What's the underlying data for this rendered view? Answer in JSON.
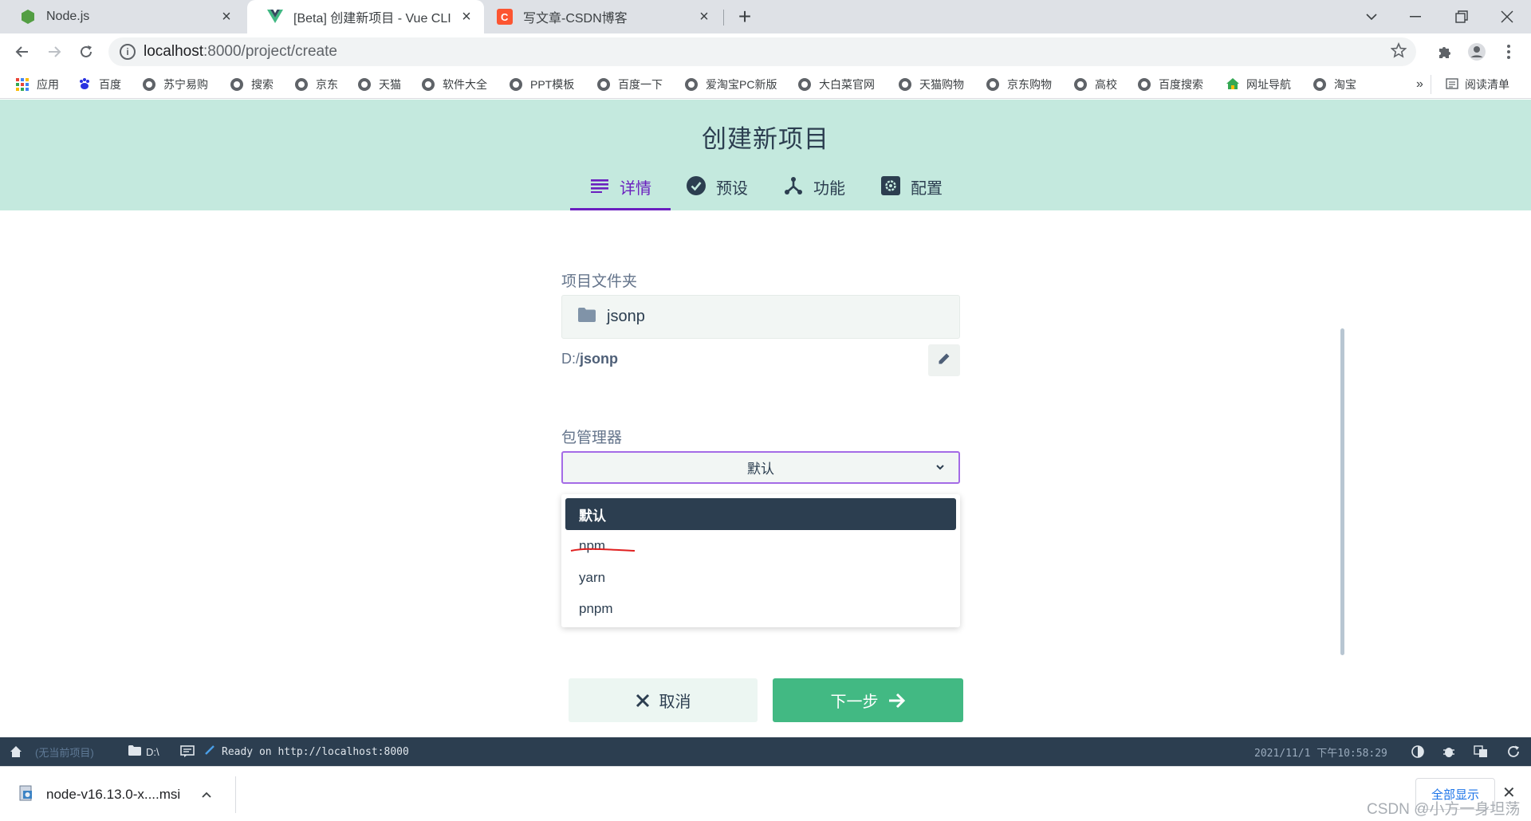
{
  "browser": {
    "tabs": [
      {
        "title": "Node.js",
        "icon": "nodejs-icon",
        "active": false
      },
      {
        "title": "[Beta] 创建新项目 - Vue CLI",
        "icon": "vue-icon",
        "active": true
      },
      {
        "title": "写文章-CSDN博客",
        "icon": "csdn-icon",
        "active": false
      }
    ],
    "url_host": "localhost",
    "url_path": ":8000/project/create",
    "bookmarks": [
      "应用",
      "百度",
      "苏宁易购",
      "搜索",
      "京东",
      "天猫",
      "软件大全",
      "PPT模板",
      "百度一下",
      "爱淘宝PC新版",
      "大白菜官网",
      "天猫购物",
      "京东购物",
      "高校",
      "百度搜索",
      "网址导航",
      "淘宝"
    ],
    "bookmarks_overflow": "»",
    "reading_list": "阅读清单"
  },
  "page": {
    "title": "创建新项目",
    "steps": [
      {
        "label": "详情",
        "icon": "list-icon",
        "active": true
      },
      {
        "label": "预设",
        "icon": "check-circle-icon",
        "active": false
      },
      {
        "label": "功能",
        "icon": "fork-icon",
        "active": false
      },
      {
        "label": "配置",
        "icon": "gear-icon",
        "active": false
      }
    ],
    "folder_label": "项目文件夹",
    "folder_value": "jsonp",
    "folder_path_prefix": "D:/",
    "folder_path_name": "jsonp",
    "pm_label": "包管理器",
    "pm_selected": "默认",
    "pm_options": [
      "默认",
      "npm",
      "yarn",
      "pnpm"
    ],
    "cancel_label": "取消",
    "next_label": "下一步"
  },
  "statusbar": {
    "project": "(无当前项目)",
    "cwd": "D:\\",
    "log": "Ready on http://localhost:8000",
    "datetime": "2021/11/1  下午10:58:29"
  },
  "downloads": {
    "file": "node-v16.13.0-x....msi",
    "show_all": "全部显示"
  },
  "watermark": "CSDN @小方一身坦荡",
  "colors": {
    "header_bg": "#c4e9de",
    "accent_purple": "#6a1fbf",
    "primary_green": "#42b983",
    "statusbar_bg": "#2c3e50"
  }
}
